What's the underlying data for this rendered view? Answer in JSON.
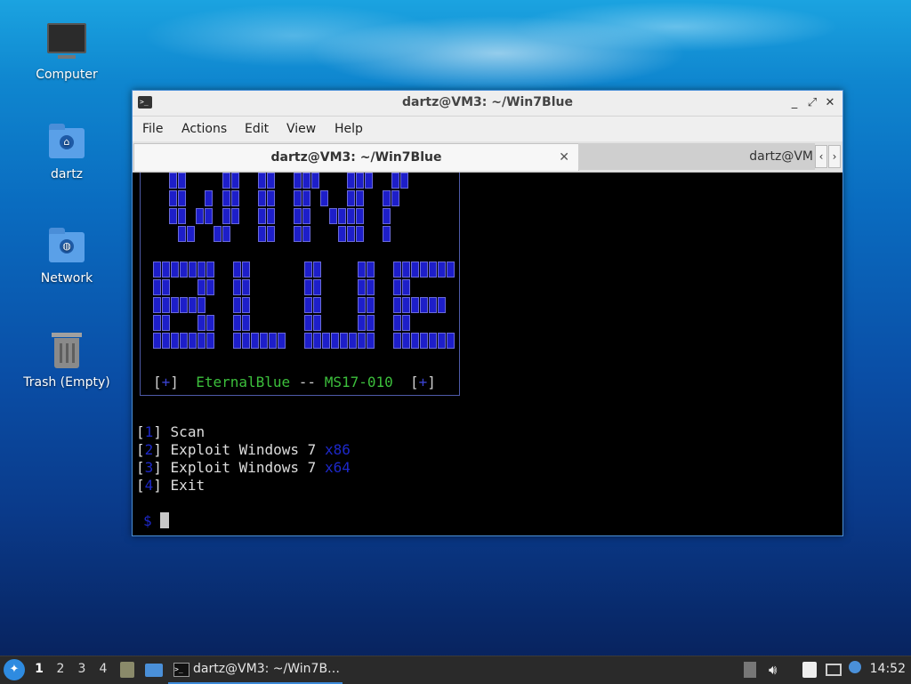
{
  "desktop": {
    "icons": [
      {
        "label": "Computer",
        "icon": "computer-icon"
      },
      {
        "label": "dartz",
        "icon": "home-folder-icon"
      },
      {
        "label": "Network",
        "icon": "network-folder-icon"
      },
      {
        "label": "Trash (Empty)",
        "icon": "trash-icon"
      }
    ]
  },
  "window": {
    "title": "dartz@VM3: ~/Win7Blue",
    "buttons": {
      "minimize": "_",
      "maximize": "⤢",
      "close": "✕"
    },
    "menu": [
      "File",
      "Actions",
      "Edit",
      "View",
      "Help"
    ],
    "tabs": [
      {
        "label": "dartz@VM3: ~/Win7Blue",
        "close": "✕",
        "active": true
      },
      {
        "label": "dartz@VM",
        "active": false
      }
    ],
    "tab_scroll": {
      "left": "‹",
      "right": "›"
    }
  },
  "terminal": {
    "banner_footer": {
      "open1": "[",
      "plus1": "+",
      "close1": "]",
      "name": "EternalBlue",
      "sep": " -- ",
      "code": "MS17-010",
      "open2": "[",
      "plus2": "+",
      "close2": "]"
    },
    "menu": [
      {
        "num": "1",
        "text": "Scan",
        "suffix": ""
      },
      {
        "num": "2",
        "text": "Exploit Windows 7 ",
        "suffix": "x86"
      },
      {
        "num": "3",
        "text": "Exploit Windows 7 ",
        "suffix": "x64"
      },
      {
        "num": "4",
        "text": "Exit",
        "suffix": ""
      }
    ],
    "prompt": "$"
  },
  "taskbar": {
    "workspaces": [
      "1",
      "2",
      "3",
      "4"
    ],
    "active_workspace": "1",
    "task_label": "dartz@VM3: ~/Win7B…",
    "clock": "14:52"
  },
  "colors": {
    "banner_block": "#1d1ec9",
    "eternal_green": "#3cbf3c",
    "accent_blue": "#3b43d3"
  }
}
